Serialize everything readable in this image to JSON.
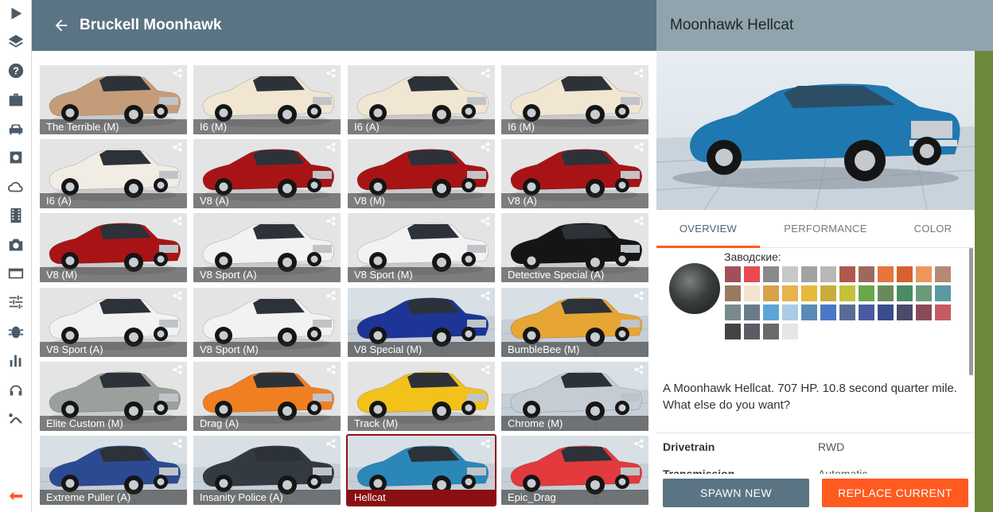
{
  "sidebar": {
    "icons": [
      "play-icon",
      "layers-icon",
      "help-icon",
      "briefcase-icon",
      "car-icon",
      "settings-icon",
      "cloud-icon",
      "film-icon",
      "camera-icon",
      "layout-icon",
      "sliders-icon",
      "bug-icon",
      "stats-icon",
      "headphones-icon",
      "route-icon",
      "back-icon"
    ]
  },
  "grid": {
    "title": "Bruckell Moonhawk",
    "tiles": [
      {
        "label": "The Terrible (M)",
        "color": "#c59c7a",
        "bg": "studio"
      },
      {
        "label": "I6 (M)",
        "color": "#f0e6d2",
        "bg": "studio"
      },
      {
        "label": "I6 (A)",
        "color": "#f0e6d2",
        "bg": "studio"
      },
      {
        "label": "I6 (M)",
        "color": "#f0e6d2",
        "bg": "studio"
      },
      {
        "label": "I6 (A)",
        "color": "#f2ede4",
        "bg": "studio"
      },
      {
        "label": "V8 (A)",
        "color": "#a81416",
        "bg": "studio"
      },
      {
        "label": "V8 (M)",
        "color": "#a81416",
        "bg": "studio"
      },
      {
        "label": "V8 (A)",
        "color": "#a81416",
        "bg": "studio"
      },
      {
        "label": "V8 (M)",
        "color": "#a81416",
        "bg": "studio"
      },
      {
        "label": "V8 Sport (A)",
        "color": "#f2f2f2",
        "bg": "studio"
      },
      {
        "label": "V8 Sport (M)",
        "color": "#f2f2f2",
        "bg": "studio"
      },
      {
        "label": "Detective Special (A)",
        "color": "#151515",
        "bg": "studio"
      },
      {
        "label": "V8 Sport (A)",
        "color": "#f2f2f2",
        "bg": "studio"
      },
      {
        "label": "V8 Sport (M)",
        "color": "#f2f2f2",
        "bg": "studio"
      },
      {
        "label": "V8 Special (M)",
        "color": "#1c3596",
        "bg": "grid"
      },
      {
        "label": "BumbleBee (M)",
        "color": "#e7a534",
        "bg": "grid"
      },
      {
        "label": "Elite Custom (M)",
        "color": "#9aa19c",
        "bg": "studio"
      },
      {
        "label": "Drag (A)",
        "color": "#f07f22",
        "bg": "studio"
      },
      {
        "label": "Track (M)",
        "color": "#f2c21b",
        "bg": "studio"
      },
      {
        "label": "Chrome (M)",
        "color": "#c6ccd4",
        "bg": "grid"
      },
      {
        "label": "Extreme Puller (A)",
        "color": "#2b4a91",
        "bg": "grid"
      },
      {
        "label": "Insanity Police (A)",
        "color": "#343a42",
        "bg": "grid"
      },
      {
        "label": "Hellcat",
        "color": "#2a87b8",
        "bg": "grid"
      },
      {
        "label": "Epic_Drag",
        "color": "#e23a3d",
        "bg": "grid"
      }
    ]
  },
  "details": {
    "title": "Moonhawk Hellcat",
    "tabs": [
      "OVERVIEW",
      "PERFORMANCE",
      "COLOR"
    ],
    "active_tab": "OVERVIEW",
    "factory_label": "Заводские:",
    "description": "A Moonhawk Hellcat. 707 HP. 10.8 second quarter mile. What else do you want?",
    "specs": [
      {
        "key": "Drivetrain",
        "value": "RWD"
      },
      {
        "key": "Transmission",
        "value": "Automatic"
      }
    ],
    "swatches": [
      "#a0505a",
      "#e84a4f",
      "#8a8a8a",
      "#c8c8c8",
      "#a2a2a2",
      "#b8b8b8",
      "#b0584c",
      "#9c6a5c",
      "#e8743c",
      "#d8602e",
      "#ec965c",
      "#b48a74",
      "#9a7a5e",
      "#f4e2cc",
      "#d6a24a",
      "#e8b24c",
      "#e8b83a",
      "#c8ac3c",
      "#c6c03a",
      "#6aa64a",
      "#6a8a5a",
      "#4a8c64",
      "#6a9a7a",
      "#5a9aa2",
      "#7a8a8c",
      "#6a7c8a",
      "#5aa6d8",
      "#a8cce6",
      "#5a8ab8",
      "#4a78c8",
      "#5a6c96",
      "#4a5aa2",
      "#3a4c8c",
      "#4a4a6a",
      "#8a4a5a",
      "#c85a64",
      "#444444",
      "#5c5c64",
      "#6a6a6a",
      "#e6e6e6"
    ],
    "buttons": {
      "spawn": "SPAWN NEW",
      "replace": "REPLACE CURRENT"
    }
  }
}
